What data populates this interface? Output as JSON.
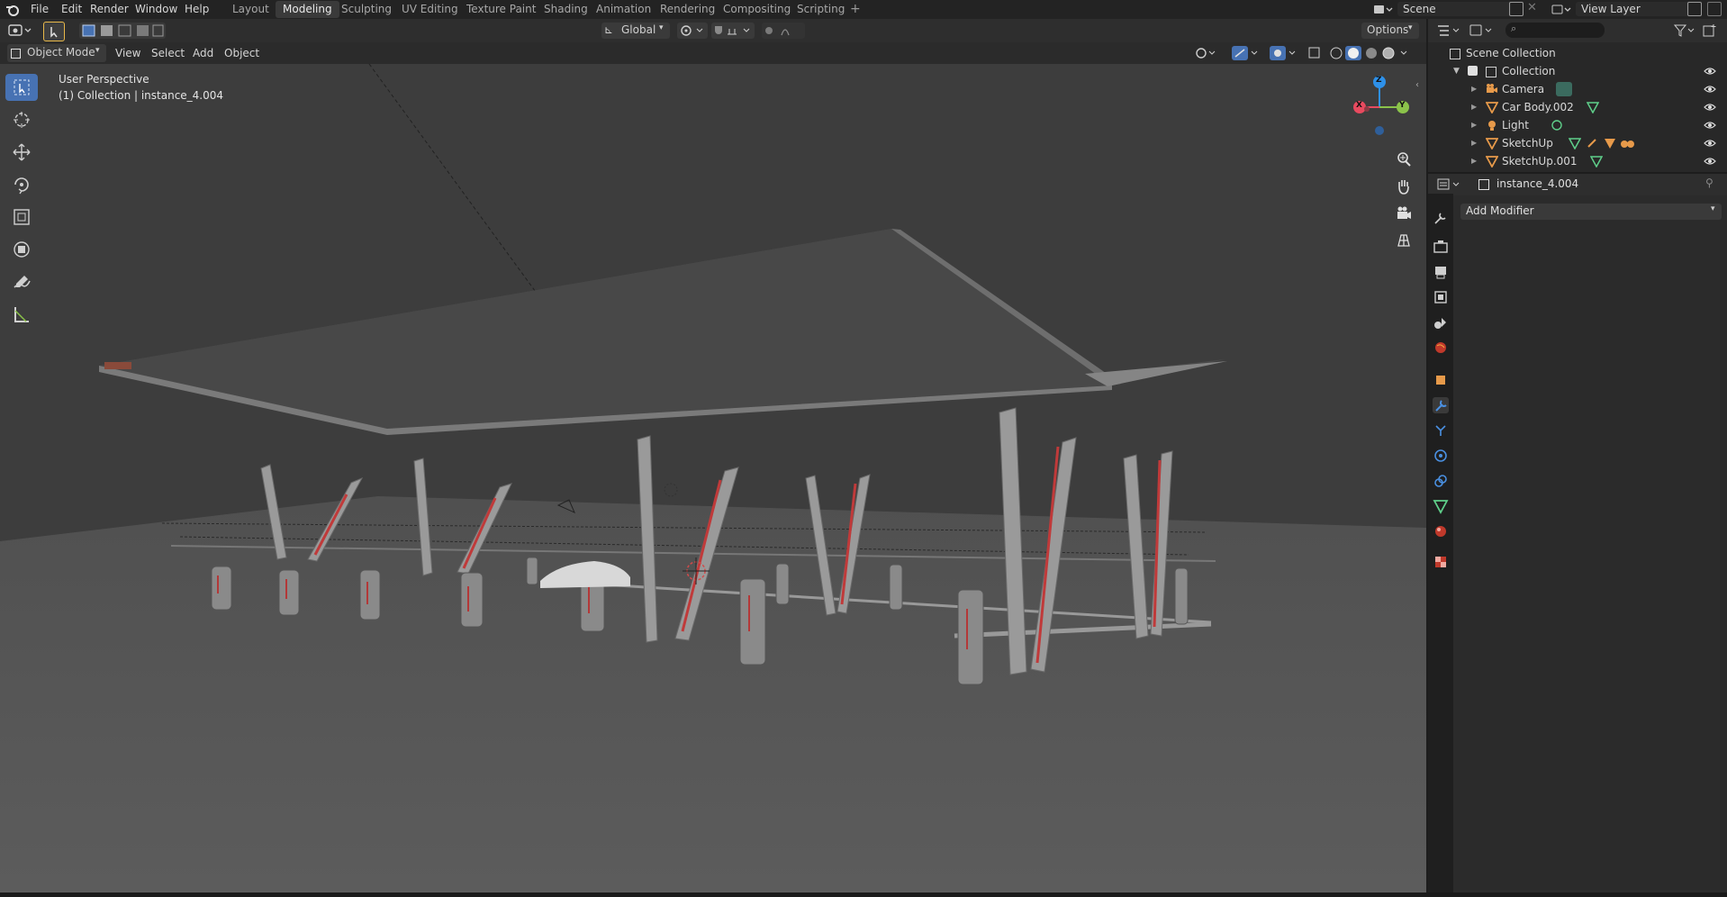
{
  "menubar": {
    "items": [
      "File",
      "Edit",
      "Render",
      "Window",
      "Help"
    ],
    "workspaces": [
      "Layout",
      "Modeling",
      "Sculpting",
      "UV Editing",
      "Texture Paint",
      "Shading",
      "Animation",
      "Rendering",
      "Compositing",
      "Scripting"
    ],
    "active_workspace": "Modeling",
    "scene_name": "Scene",
    "view_layer_name": "View Layer"
  },
  "header": {
    "mode": "Object Mode",
    "menus": [
      "View",
      "Select",
      "Add",
      "Object"
    ],
    "orientation": "Global",
    "options_label": "Options"
  },
  "viewport": {
    "view_name": "User Perspective",
    "context": "(1) Collection | instance_4.004",
    "gizmo_labels": {
      "x": "X",
      "y": "Y",
      "z": "Z"
    }
  },
  "outliner": {
    "root": "Scene Collection",
    "collection": "Collection",
    "items": [
      "Camera",
      "Car Body.002",
      "Light",
      "SketchUp",
      "SketchUp.001"
    ]
  },
  "properties": {
    "object_name": "instance_4.004",
    "add_modifier_label": "Add Modifier"
  },
  "colors": {
    "accent": "#4772b3",
    "active_tab": "#3a3a3a",
    "axis_x": "#e84a5f",
    "axis_y": "#8bc34a",
    "axis_z": "#2e90e8"
  }
}
